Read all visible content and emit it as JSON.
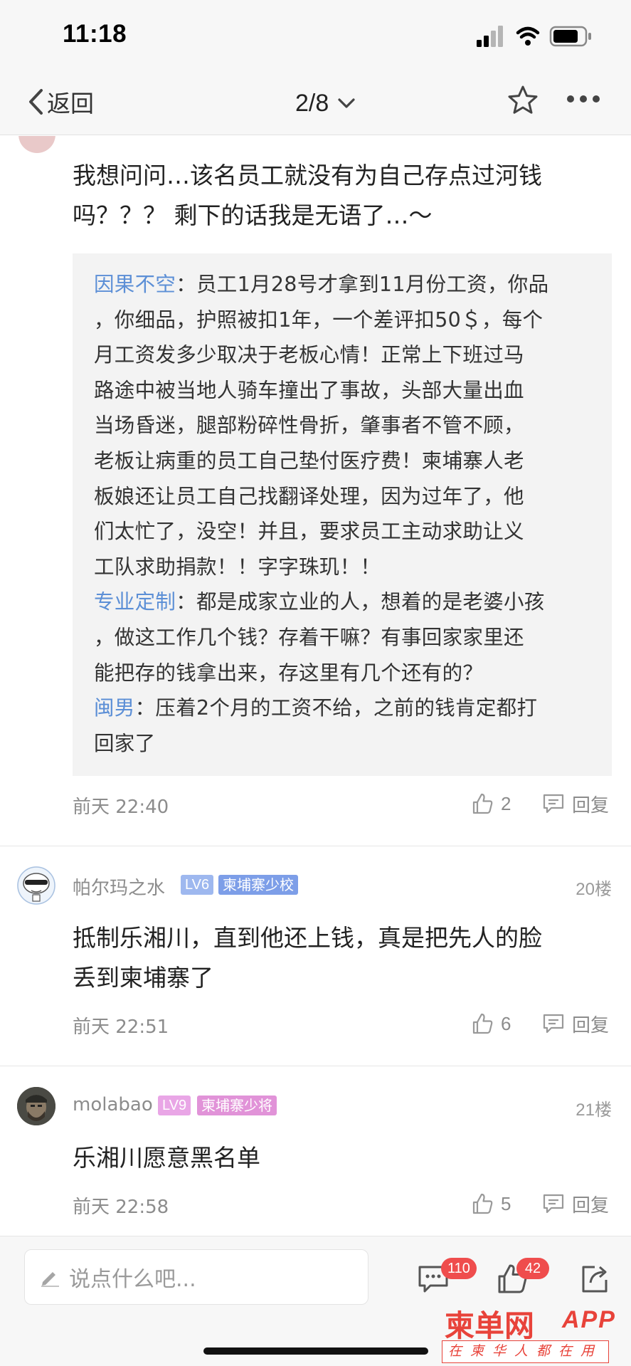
{
  "status_bar": {
    "time": "11:18"
  },
  "nav": {
    "back_label": "返回",
    "page_indicator": "2/8"
  },
  "comment19": {
    "text_lines": [
      "我想问问…该名员工就没有为自己存点过河钱",
      "吗？？？ 剩下的话我是无语了…～"
    ],
    "replies": [
      {
        "user": "因果不空",
        "lines": [
          "：员工1月28号才拿到11月份工资，你品",
          "，你细品，护照被扣1年，一个差评扣50＄，每个",
          "月工资发多少取决于老板心情！正常上下班过马",
          "路途中被当地人骑车撞出了事故，头部大量出血",
          "当场昏迷，腿部粉碎性骨折，肇事者不管不顾，",
          "老板让病重的员工自己垫付医疗费！柬埔寨人老",
          "板娘还让员工自己找翻译处理，因为过年了，他",
          "们太忙了，没空！并且，要求员工主动求助让义",
          "工队求助捐款！！字字珠玑！！"
        ]
      },
      {
        "user": "专业定制",
        "lines": [
          "：都是成家立业的人，想着的是老婆小孩",
          "，做这工作几个钱？存着干嘛？有事回家家里还",
          "能把存的钱拿出来，存这里有几个还有的？"
        ]
      },
      {
        "user": "闽男",
        "lines": [
          "：压着2个月的工资不给，之前的钱肯定都打",
          "回家了"
        ]
      }
    ],
    "time": "前天 22:40",
    "likes": "2",
    "reply_label": "回复"
  },
  "comment20": {
    "user": "帕尔玛之水",
    "level": "LV6",
    "rank": "柬埔寨少校",
    "floor": "20楼",
    "text_lines": [
      "抵制乐湘川，直到他还上钱，真是把先人的脸",
      "丢到柬埔寨了"
    ],
    "time": "前天 22:51",
    "likes": "6",
    "reply_label": "回复"
  },
  "comment21": {
    "user": "molabao",
    "level": "LV9",
    "rank": "柬埔寨少将",
    "floor": "21楼",
    "text_lines": [
      "乐湘川愿意黑名单"
    ],
    "time": "前天 22:58",
    "likes": "5",
    "reply_label": "回复"
  },
  "bottom_bar": {
    "input_placeholder": "说点什么吧...",
    "comment_count": "110",
    "like_count": "42"
  },
  "watermark": {
    "brand": "柬单网",
    "app": "APP",
    "slogan": "在柬华人都在用"
  },
  "colors": {
    "link_blue": "#5c8fd6",
    "badge_lv6": "#9eb8ef",
    "badge_rank6": "#7d9ee8",
    "badge_lv9": "#e9a6e6",
    "badge_rank9": "#e193d8",
    "badge_red": "#ef4d4d",
    "brand_red": "#e8433a"
  }
}
